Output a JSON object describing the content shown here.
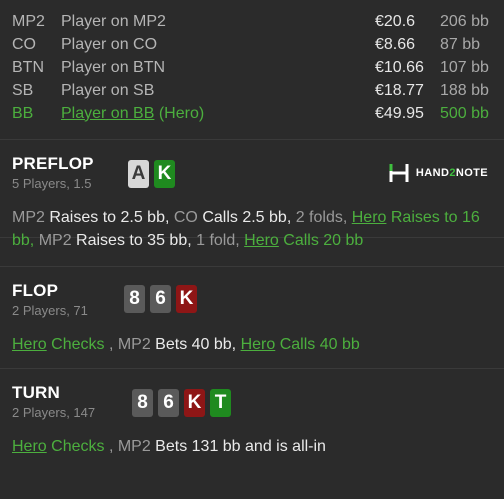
{
  "players": [
    {
      "pos": "MP2",
      "name": "Player on MP2",
      "stack": "€20.6",
      "bb": "206 bb",
      "hero": false
    },
    {
      "pos": "CO",
      "name": "Player on CO",
      "stack": "€8.66",
      "bb": "87 bb",
      "hero": false
    },
    {
      "pos": "BTN",
      "name": "Player on BTN",
      "stack": "€10.66",
      "bb": "107 bb",
      "hero": false
    },
    {
      "pos": "SB",
      "name": "Player on SB",
      "stack": "€18.77",
      "bb": "188 bb",
      "hero": false
    },
    {
      "pos": "BB",
      "name": "Player on BB",
      "name_suffix": " (Hero)",
      "stack": "€49.95",
      "bb": "500 bb",
      "hero": true
    }
  ],
  "logo": {
    "part1": "HAND",
    "part2": "2",
    "part3": "NOTE",
    "icon": "h-logo-icon"
  },
  "preflop": {
    "title": "PREFLOP",
    "sub": "5 Players, 1.5",
    "cards": [
      {
        "rank": "A",
        "color": "grey"
      },
      {
        "rank": "K",
        "color": "green"
      }
    ],
    "actions": [
      {
        "pl": "MP2",
        "text": " Raises to 2.5 bb, "
      },
      {
        "pl": "CO",
        "text": " Calls 2.5 bb, "
      },
      {
        "pl": "2 folds, ",
        "text": ""
      },
      {
        "hero": "Hero",
        "heroText": " Raises to 16 bb, "
      },
      {
        "pl": "MP2",
        "text": " Raises to 35 bb, "
      },
      {
        "pl": "1 fold, ",
        "text": ""
      },
      {
        "hero": "Hero",
        "heroText": " Calls 20 bb"
      }
    ]
  },
  "flop": {
    "title": "FLOP",
    "sub": "2 Players, 71",
    "cards": [
      {
        "rank": "8",
        "color": "grey-dark"
      },
      {
        "rank": "6",
        "color": "grey-dark"
      },
      {
        "rank": "K",
        "color": "red"
      }
    ],
    "actions": [
      {
        "hero": "Hero",
        "heroText": " Checks "
      },
      {
        "pl": ", MP2",
        "text": " Bets 40 bb, "
      },
      {
        "hero": "Hero",
        "heroText": " Calls 40 bb"
      }
    ]
  },
  "turn": {
    "title": "TURN",
    "sub": "2 Players, 147",
    "cards": [
      {
        "rank": "8",
        "color": "grey-dark"
      },
      {
        "rank": "6",
        "color": "grey-dark"
      },
      {
        "rank": "K",
        "color": "red"
      },
      {
        "rank": "T",
        "color": "green"
      }
    ],
    "actions": [
      {
        "hero": "Hero",
        "heroText": " Checks "
      },
      {
        "pl": ", MP2",
        "text": " Bets 131 bb and is all-in"
      }
    ]
  }
}
